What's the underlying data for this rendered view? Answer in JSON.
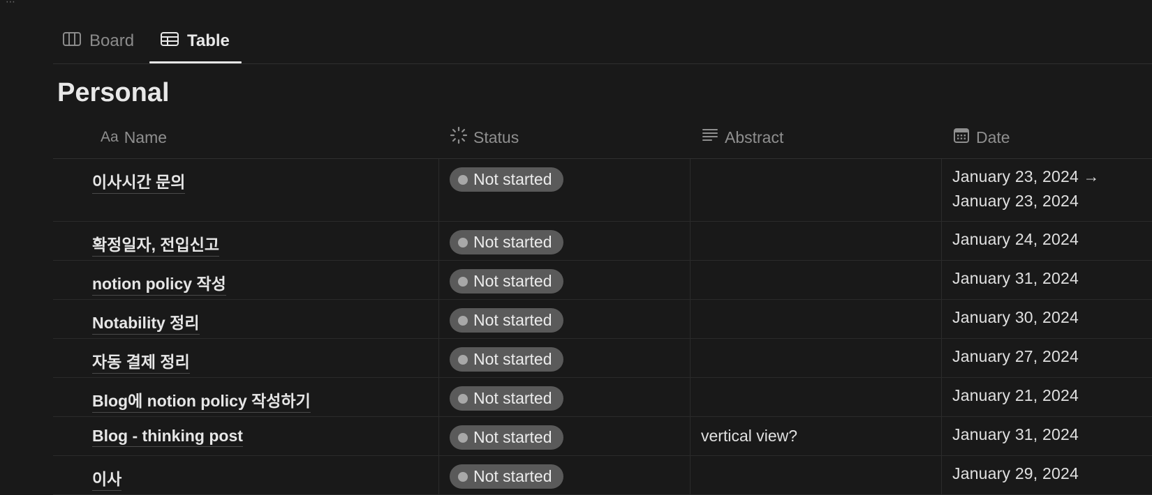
{
  "views": {
    "board_label": "Board",
    "table_label": "Table"
  },
  "database": {
    "title": "Personal"
  },
  "columns": {
    "name_prefix": "Aa",
    "name": "Name",
    "status": "Status",
    "abstract": "Abstract",
    "date": "Date"
  },
  "rows": [
    {
      "name": "이사시간 문의",
      "status": "Not started",
      "abstract": "",
      "date": "January 23, 2024 →",
      "date2": "January 23, 2024"
    },
    {
      "name": "확정일자, 전입신고",
      "status": "Not started",
      "abstract": "",
      "date": "January 24, 2024",
      "date2": ""
    },
    {
      "name": "notion policy 작성",
      "status": "Not started",
      "abstract": "",
      "date": "January 31, 2024",
      "date2": ""
    },
    {
      "name": "Notability 정리",
      "status": "Not started",
      "abstract": "",
      "date": "January 30, 2024",
      "date2": ""
    },
    {
      "name": "자동 결제 정리",
      "status": "Not started",
      "abstract": "",
      "date": "January 27, 2024",
      "date2": ""
    },
    {
      "name": "Blog에 notion policy 작성하기",
      "status": "Not started",
      "abstract": "",
      "date": "January 21, 2024",
      "date2": ""
    },
    {
      "name": "Blog - thinking post",
      "status": "Not started",
      "abstract": "vertical view?",
      "date": "January 31, 2024",
      "date2": ""
    },
    {
      "name": "이사",
      "status": "Not started",
      "abstract": "",
      "date": "January 29, 2024",
      "date2": ""
    }
  ],
  "colors": {
    "background": "#191919",
    "pill": "#5a5a5a",
    "divider": "#2f2f2f"
  }
}
